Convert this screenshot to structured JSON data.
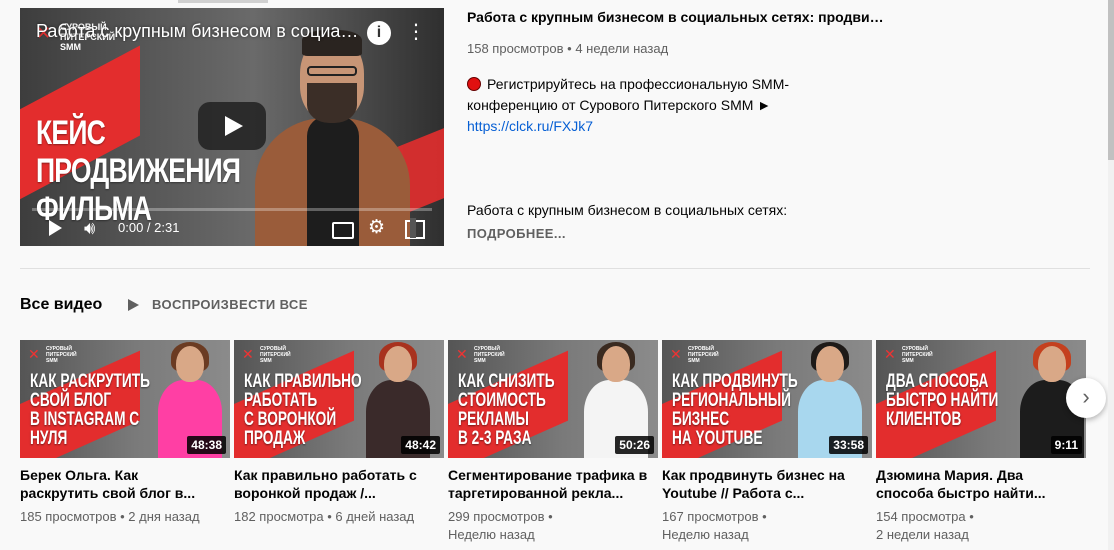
{
  "featured": {
    "overlay_title": "Работа с крупным бизнесом в социальных сетях: продвижение",
    "logo_lines": [
      "СУРОВЫЙ",
      "ПИТЕРСКИЙ",
      "SMM"
    ],
    "thumb_text_lines": [
      "КЕЙС",
      "ПРОДВИЖЕНИЯ",
      "ФИЛЬМА"
    ],
    "info_icon": "i",
    "more_icon": "⋮",
    "time": "0:00 / 2:31",
    "title": "Работа с крупным бизнесом в социальных сетях: продвижение",
    "views": "158 просмотров",
    "age": "4 недели назад",
    "desc_text": "Регистрируйтесь на профессиональную SMM-конференцию от Сурового Питерского SMM ►",
    "desc_link": "https://clck.ru/FXJk7",
    "desc_text2": "Работа с крупным бизнесом в социальных сетях:",
    "more_label": "ПОДРОБНЕЕ..."
  },
  "shelf": {
    "title": "Все видео",
    "play_all_label": "ВОСПРОИЗВЕСТИ ВСЕ"
  },
  "videos": [
    {
      "thumb_lines": [
        "КАК РАСКРУТИТЬ",
        "СВОЙ БЛОГ",
        "В INSTAGRAM С НУЛЯ"
      ],
      "duration": "48:38",
      "title": "Берек Ольга. Как раскрутить свой блог в...",
      "meta": "185 просмотров • 2 дня назад",
      "person": {
        "hair": "#6b3b22",
        "body": "#ff3fa4"
      }
    },
    {
      "thumb_lines": [
        "КАК ПРАВИЛЬНО",
        "РАБОТАТЬ",
        "С ВОРОНКОЙ",
        "ПРОДАЖ"
      ],
      "duration": "48:42",
      "title": "Как правильно работать с воронкой продаж /...",
      "meta": "182 просмотра • 6 дней назад",
      "person": {
        "hair": "#a8321e",
        "body": "#3a2a2a"
      }
    },
    {
      "thumb_lines": [
        "КАК СНИЗИТЬ",
        "СТОИМОСТЬ",
        "РЕКЛАМЫ",
        "В 2-3 РАЗА"
      ],
      "duration": "50:26",
      "title": "Сегментирование трафика в таргетированной рекла...",
      "meta": "299 просмотров •",
      "meta2": "Неделю назад",
      "person": {
        "hair": "#3a2a20",
        "body": "#f4f4f4"
      }
    },
    {
      "thumb_lines": [
        "КАК ПРОДВИНУТЬ",
        "РЕГИОНАЛЬНЫЙ",
        "БИЗНЕС",
        "НА YOUTUBE"
      ],
      "duration": "33:58",
      "title": "Как продвинуть бизнес на Youtube // Работа с...",
      "meta": "167 просмотров •",
      "meta2": "Неделю назад",
      "person": {
        "hair": "#1e1a18",
        "body": "#a8d7ee"
      }
    },
    {
      "thumb_lines": [
        "ДВА СПОСОБА",
        "БЫСТРО НАЙТИ",
        "КЛИЕНТОВ"
      ],
      "duration": "9:11",
      "title": "Дзюмина Мария. Два способа быстро найти...",
      "meta": "154 просмотра •",
      "meta2": "2 недели назад",
      "person": {
        "hair": "#c4401e",
        "body": "#1c1c1c"
      }
    }
  ],
  "next_icon": "›"
}
